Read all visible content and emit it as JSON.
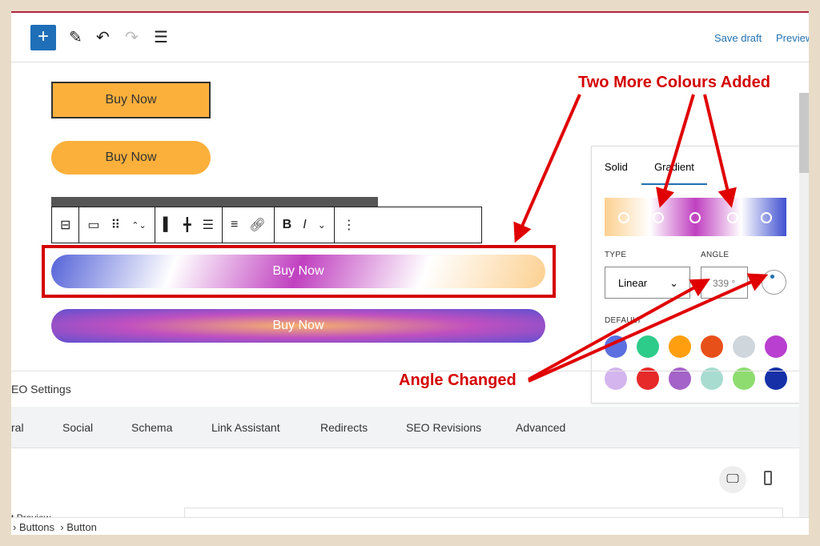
{
  "topbar": {
    "save_draft": "Save draft",
    "preview": "Preview"
  },
  "buttons": [
    "Buy Now",
    "Buy Now",
    "Buy Now",
    "Buy Now"
  ],
  "panel": {
    "tabs": [
      "Solid",
      "Gradient"
    ],
    "type_label": "TYPE",
    "type_value": "Linear",
    "angle_label": "ANGLE",
    "angle_value": "339",
    "angle_unit": "°",
    "defaults_label": "DEFAULT",
    "swatches": [
      "#5b6fe0",
      "#2ecc8a",
      "#ff9f10",
      "#e8501a",
      "#cfd6dc",
      "#b83fd0",
      "#d4b5ee",
      "#e62a2a",
      "#a463c8",
      "#a8dcd0",
      "#8edc70",
      "#1630a8"
    ]
  },
  "seo": {
    "title": "EO Settings",
    "tabs": [
      "ral",
      "Social",
      "Schema",
      "Link Assistant",
      "Redirects",
      "SEO Revisions",
      "Advanced"
    ],
    "preview": "t Preview"
  },
  "breadcrumb": [
    "Buttons",
    "Button"
  ],
  "annotations": {
    "colours": "Two More Colours Added",
    "angle": "Angle Changed"
  }
}
